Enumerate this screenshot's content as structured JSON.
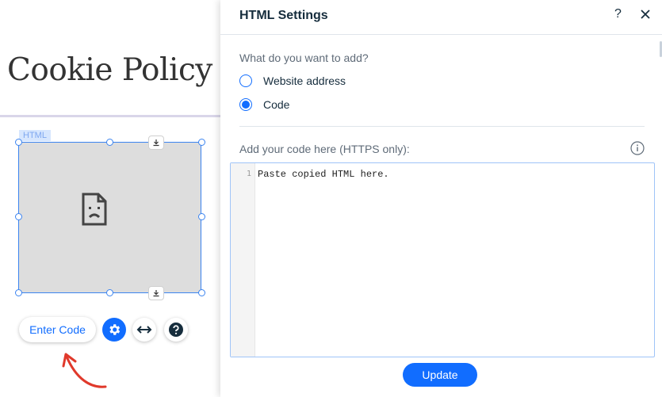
{
  "canvas": {
    "page_title": "Cookie Policy",
    "element_tag": "HTML",
    "enter_code_label": "Enter Code",
    "icons": {
      "gear": "gear-icon",
      "stretch": "stretch-arrows-icon",
      "help": "help-icon",
      "broken": "broken-document-icon",
      "anchor": "download-anchor-icon"
    }
  },
  "panel": {
    "title": "HTML Settings",
    "help_label": "?",
    "question": "What do you want to add?",
    "options": [
      {
        "label": "Website address",
        "selected": false
      },
      {
        "label": "Code",
        "selected": true
      }
    ],
    "code_label": "Add your code here (HTTPS only):",
    "editor": {
      "line_number": "1",
      "content": "Paste copied HTML here."
    },
    "update_label": "Update"
  },
  "colors": {
    "accent": "#116dff",
    "selection_border": "#3b84f0",
    "annotation_arrow": "#e0392b"
  }
}
